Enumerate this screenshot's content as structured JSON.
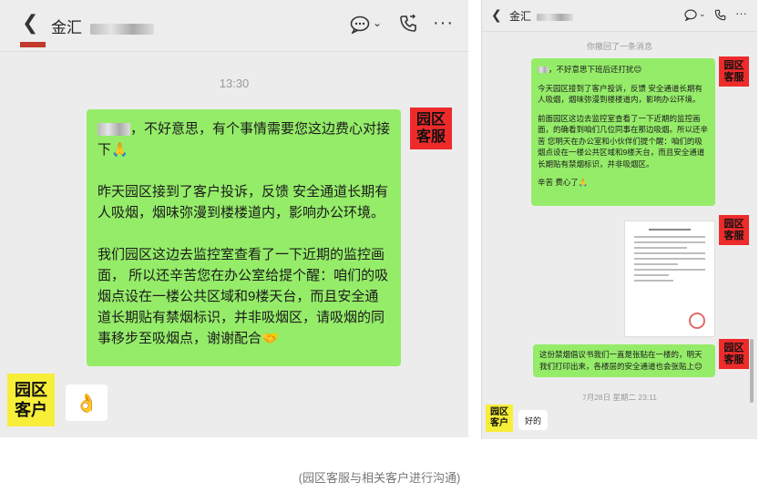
{
  "left_panel": {
    "title": "金汇",
    "timestamp": "13:30",
    "staff_tag": "园区\n客服",
    "customer_tag": "园区\n客户",
    "message": {
      "p1": "，不好意思，有个事情需要您这边费心对接下🙏",
      "p2": "昨天园区接到了客户投诉，反馈     安全通道长期有人吸烟，烟味弥漫到楼楼道内，影响办公环境。",
      "p3": "我们园区这边去监控室查看了一下近期的监控画面，          所以还辛苦您在办公室给提个醒：咱们的吸烟点设在一楼公共区域和9楼天台，而且安全通道长期贴有禁烟标识，并非吸烟区，请吸烟的同事移步至吸烟点，谢谢配合🤝"
    },
    "reply_emoji": "👌",
    "icons": [
      "chat-icon",
      "chevron-down-icon",
      "phone-icon",
      "more-icon"
    ]
  },
  "right_panel": {
    "title": "金汇",
    "recall_notice": "你撤回了一条消息",
    "staff_tag": "园区\n客服",
    "customer_tag": "园区\n客户",
    "message1": {
      "p1": "，不好意思下班后还打扰😊",
      "p2": "今天园区接到了客户投诉，反馈    安全通道长期有人吸烟，烟味弥漫到楼楼道内，影响办公环境。",
      "p3": "前面园区这边去监控室查看了一下近期的监控画面，的确看到咱们几位同事在那边吸烟。所以还辛苦    您明天在办公室和小伙伴们提个醒：咱们的吸烟点设在一楼公共区域和9楼天台，而且安全通道长期贴有禁烟标识，并非吸烟区。",
      "p4": "辛苦    费心了🙏"
    },
    "message2": "这份禁烟倡议书我们一直是张贴在一楼的，明天我们打印出来，各楼层的安全通道也会张贴上😊",
    "timestamp": "7月28日 星期二 23:11",
    "customer_reply": "好的"
  },
  "caption": "(园区客服与相关客户进行沟通)"
}
